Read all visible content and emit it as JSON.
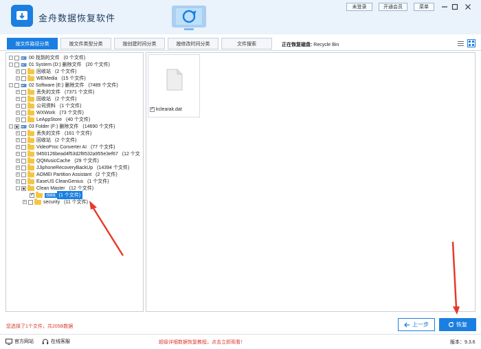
{
  "app": {
    "title": "金舟数据恢复软件"
  },
  "titlebar": {
    "buttons": [
      {
        "label": "未登录"
      },
      {
        "label": "开通会员"
      },
      {
        "label": "菜单"
      }
    ]
  },
  "tabs": [
    {
      "label": "按文件路径分类",
      "active": true
    },
    {
      "label": "按文件类型分类",
      "active": false
    },
    {
      "label": "按创建时间分类",
      "active": false
    },
    {
      "label": "按修改时间分类",
      "active": false
    },
    {
      "label": "文件搜索",
      "active": false
    }
  ],
  "current_disk": {
    "label": "正在恢复磁盘:",
    "value": "Recycle Bin"
  },
  "tree": [
    {
      "label": "00 找到的文件",
      "count": "(0 个文件)",
      "kind": "drive",
      "expander": "-",
      "check": "none"
    },
    {
      "label": "01 System (D:) 删除文件",
      "count": "(20 个文件)",
      "kind": "drive",
      "expander": "-",
      "check": "none"
    },
    {
      "label": "回收站",
      "count": "(2 个文件)",
      "kind": "folder",
      "expander": "+",
      "check": "none"
    },
    {
      "label": "WEMedia",
      "count": "(15 个文件)",
      "kind": "folder",
      "expander": "+",
      "check": "none"
    },
    {
      "label": "02 Software (E:) 删除文件",
      "count": "(7489 个文件)",
      "kind": "drive",
      "expander": "-",
      "check": "none"
    },
    {
      "label": "丢失的文件",
      "count": "(7371 个文件)",
      "kind": "folder",
      "expander": "+",
      "check": "none"
    },
    {
      "label": "回收站",
      "count": "(2 个文件)",
      "kind": "folder",
      "expander": "+",
      "check": "none"
    },
    {
      "label": "公司资料",
      "count": "(1 个文件)",
      "kind": "folder",
      "expander": "+",
      "check": "none"
    },
    {
      "label": "WXWork",
      "count": "(73 个文件)",
      "kind": "folder",
      "expander": "+",
      "check": "none"
    },
    {
      "label": "LeAppStore",
      "count": "(40 个文件)",
      "kind": "folder",
      "expander": "+",
      "check": "none"
    },
    {
      "label": "03 Folder (F:) 删除文件",
      "count": "(14690 个文件)",
      "kind": "drive",
      "expander": "-",
      "check": "partial"
    },
    {
      "label": "丢失的文件",
      "count": "(161 个文件)",
      "kind": "folder",
      "expander": "+",
      "check": "none"
    },
    {
      "label": "回收站",
      "count": "(2 个文件)",
      "kind": "folder",
      "expander": "+",
      "check": "none"
    },
    {
      "label": "VideoProc Converter AI",
      "count": "(77 个文件)",
      "kind": "folder",
      "expander": "+",
      "check": "none"
    },
    {
      "label": "9450126bead4f53d2f8532a955e3ef67",
      "count": "(12 个文",
      "kind": "folder",
      "expander": "+",
      "check": "none"
    },
    {
      "label": "QQMusicCache",
      "count": "(29 个文件)",
      "kind": "folder",
      "expander": "+",
      "check": "none"
    },
    {
      "label": "JJiphoneRecoveryBackUp",
      "count": "(14394 个文件)",
      "kind": "folder",
      "expander": "+",
      "check": "none"
    },
    {
      "label": "AOMEI Partition Assistant",
      "count": "(2 个文件)",
      "kind": "folder",
      "expander": "+",
      "check": "none"
    },
    {
      "label": "EaseUS CleanGenius",
      "count": "(1 个文件)",
      "kind": "folder",
      "expander": "+",
      "check": "none"
    },
    {
      "label": "Clean Master",
      "count": "(12 个文件)",
      "kind": "folder",
      "expander": "-",
      "check": "partial"
    },
    {
      "label": "data",
      "count": "(1 个文件)",
      "kind": "folder",
      "expander": "",
      "check": "checked",
      "selected": true
    },
    {
      "label": "security",
      "count": "(11 个文件)",
      "kind": "folder",
      "expander": "+",
      "check": "none"
    }
  ],
  "files": [
    {
      "name": "kclearak.dat",
      "checked": true
    }
  ],
  "status": {
    "selection": "您选择了1个文件，共205B数据"
  },
  "actions": {
    "prev_label": "上一步",
    "recover_label": "恢复"
  },
  "footer": {
    "website": "官方网站",
    "support": "在线客服",
    "promo": "超级详细数据恢复教程，点击立即观看！",
    "version": "版本：9.3.6"
  },
  "colors": {
    "accent": "#1a7fe0",
    "folder": "#f5c542",
    "alert": "#d63a2f",
    "annotation": "#e8392b"
  }
}
